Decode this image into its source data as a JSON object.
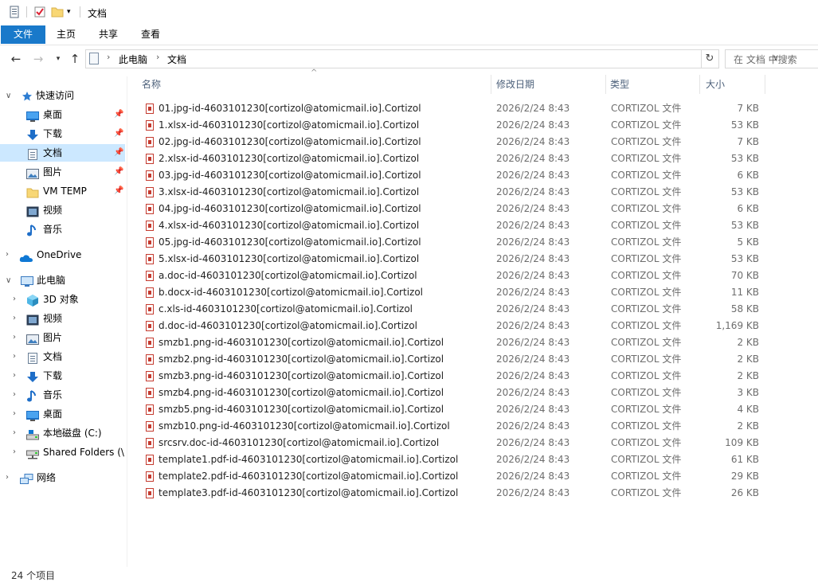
{
  "window": {
    "title": "文档"
  },
  "ribbon": {
    "tabs": [
      "文件",
      "主页",
      "共享",
      "查看"
    ]
  },
  "address": {
    "breadcrumb": [
      "此电脑",
      "文档"
    ],
    "search_placeholder": "在 文档 中搜索"
  },
  "nav": {
    "quick_access": {
      "label": "快速访问",
      "items": [
        {
          "label": "桌面",
          "pinned": true
        },
        {
          "label": "下载",
          "pinned": true
        },
        {
          "label": "文档",
          "pinned": true,
          "selected": true
        },
        {
          "label": "图片",
          "pinned": true
        },
        {
          "label": "VM TEMP",
          "pinned": true
        },
        {
          "label": "视频",
          "pinned": false
        },
        {
          "label": "音乐",
          "pinned": false
        }
      ]
    },
    "onedrive": {
      "label": "OneDrive"
    },
    "this_pc": {
      "label": "此电脑",
      "items": [
        {
          "label": "3D 对象"
        },
        {
          "label": "视频"
        },
        {
          "label": "图片"
        },
        {
          "label": "文档"
        },
        {
          "label": "下载"
        },
        {
          "label": "音乐"
        },
        {
          "label": "桌面"
        },
        {
          "label": "本地磁盘 (C:)"
        },
        {
          "label": "Shared Folders (\\"
        }
      ]
    },
    "network": {
      "label": "网络"
    }
  },
  "columns": {
    "name": "名称",
    "date": "修改日期",
    "type": "类型",
    "size": "大小"
  },
  "files": [
    {
      "name": "01.jpg-id-4603101230[cortizol@atomicmail.io].Cortizol",
      "date": "2026/2/24 8:43",
      "type": "CORTIZOL 文件",
      "size": "7 KB"
    },
    {
      "name": "1.xlsx-id-4603101230[cortizol@atomicmail.io].Cortizol",
      "date": "2026/2/24 8:43",
      "type": "CORTIZOL 文件",
      "size": "53 KB"
    },
    {
      "name": "02.jpg-id-4603101230[cortizol@atomicmail.io].Cortizol",
      "date": "2026/2/24 8:43",
      "type": "CORTIZOL 文件",
      "size": "7 KB"
    },
    {
      "name": "2.xlsx-id-4603101230[cortizol@atomicmail.io].Cortizol",
      "date": "2026/2/24 8:43",
      "type": "CORTIZOL 文件",
      "size": "53 KB"
    },
    {
      "name": "03.jpg-id-4603101230[cortizol@atomicmail.io].Cortizol",
      "date": "2026/2/24 8:43",
      "type": "CORTIZOL 文件",
      "size": "6 KB"
    },
    {
      "name": "3.xlsx-id-4603101230[cortizol@atomicmail.io].Cortizol",
      "date": "2026/2/24 8:43",
      "type": "CORTIZOL 文件",
      "size": "53 KB"
    },
    {
      "name": "04.jpg-id-4603101230[cortizol@atomicmail.io].Cortizol",
      "date": "2026/2/24 8:43",
      "type": "CORTIZOL 文件",
      "size": "6 KB"
    },
    {
      "name": "4.xlsx-id-4603101230[cortizol@atomicmail.io].Cortizol",
      "date": "2026/2/24 8:43",
      "type": "CORTIZOL 文件",
      "size": "53 KB"
    },
    {
      "name": "05.jpg-id-4603101230[cortizol@atomicmail.io].Cortizol",
      "date": "2026/2/24 8:43",
      "type": "CORTIZOL 文件",
      "size": "5 KB"
    },
    {
      "name": "5.xlsx-id-4603101230[cortizol@atomicmail.io].Cortizol",
      "date": "2026/2/24 8:43",
      "type": "CORTIZOL 文件",
      "size": "53 KB"
    },
    {
      "name": "a.doc-id-4603101230[cortizol@atomicmail.io].Cortizol",
      "date": "2026/2/24 8:43",
      "type": "CORTIZOL 文件",
      "size": "70 KB"
    },
    {
      "name": "b.docx-id-4603101230[cortizol@atomicmail.io].Cortizol",
      "date": "2026/2/24 8:43",
      "type": "CORTIZOL 文件",
      "size": "11 KB"
    },
    {
      "name": "c.xls-id-4603101230[cortizol@atomicmail.io].Cortizol",
      "date": "2026/2/24 8:43",
      "type": "CORTIZOL 文件",
      "size": "58 KB"
    },
    {
      "name": "d.doc-id-4603101230[cortizol@atomicmail.io].Cortizol",
      "date": "2026/2/24 8:43",
      "type": "CORTIZOL 文件",
      "size": "1,169 KB"
    },
    {
      "name": "smzb1.png-id-4603101230[cortizol@atomicmail.io].Cortizol",
      "date": "2026/2/24 8:43",
      "type": "CORTIZOL 文件",
      "size": "2 KB"
    },
    {
      "name": "smzb2.png-id-4603101230[cortizol@atomicmail.io].Cortizol",
      "date": "2026/2/24 8:43",
      "type": "CORTIZOL 文件",
      "size": "2 KB"
    },
    {
      "name": "smzb3.png-id-4603101230[cortizol@atomicmail.io].Cortizol",
      "date": "2026/2/24 8:43",
      "type": "CORTIZOL 文件",
      "size": "2 KB"
    },
    {
      "name": "smzb4.png-id-4603101230[cortizol@atomicmail.io].Cortizol",
      "date": "2026/2/24 8:43",
      "type": "CORTIZOL 文件",
      "size": "3 KB"
    },
    {
      "name": "smzb5.png-id-4603101230[cortizol@atomicmail.io].Cortizol",
      "date": "2026/2/24 8:43",
      "type": "CORTIZOL 文件",
      "size": "4 KB"
    },
    {
      "name": "smzb10.png-id-4603101230[cortizol@atomicmail.io].Cortizol",
      "date": "2026/2/24 8:43",
      "type": "CORTIZOL 文件",
      "size": "2 KB"
    },
    {
      "name": "srcsrv.doc-id-4603101230[cortizol@atomicmail.io].Cortizol",
      "date": "2026/2/24 8:43",
      "type": "CORTIZOL 文件",
      "size": "109 KB"
    },
    {
      "name": "template1.pdf-id-4603101230[cortizol@atomicmail.io].Cortizol",
      "date": "2026/2/24 8:43",
      "type": "CORTIZOL 文件",
      "size": "61 KB"
    },
    {
      "name": "template2.pdf-id-4603101230[cortizol@atomicmail.io].Cortizol",
      "date": "2026/2/24 8:43",
      "type": "CORTIZOL 文件",
      "size": "29 KB"
    },
    {
      "name": "template3.pdf-id-4603101230[cortizol@atomicmail.io].Cortizol",
      "date": "2026/2/24 8:43",
      "type": "CORTIZOL 文件",
      "size": "26 KB"
    }
  ],
  "status": {
    "item_count": "24 个项目"
  },
  "colors": {
    "accent": "#1979ca",
    "selected": "#cce8ff",
    "header_text": "#4c607a",
    "secondary_text": "#6d6d6d"
  }
}
